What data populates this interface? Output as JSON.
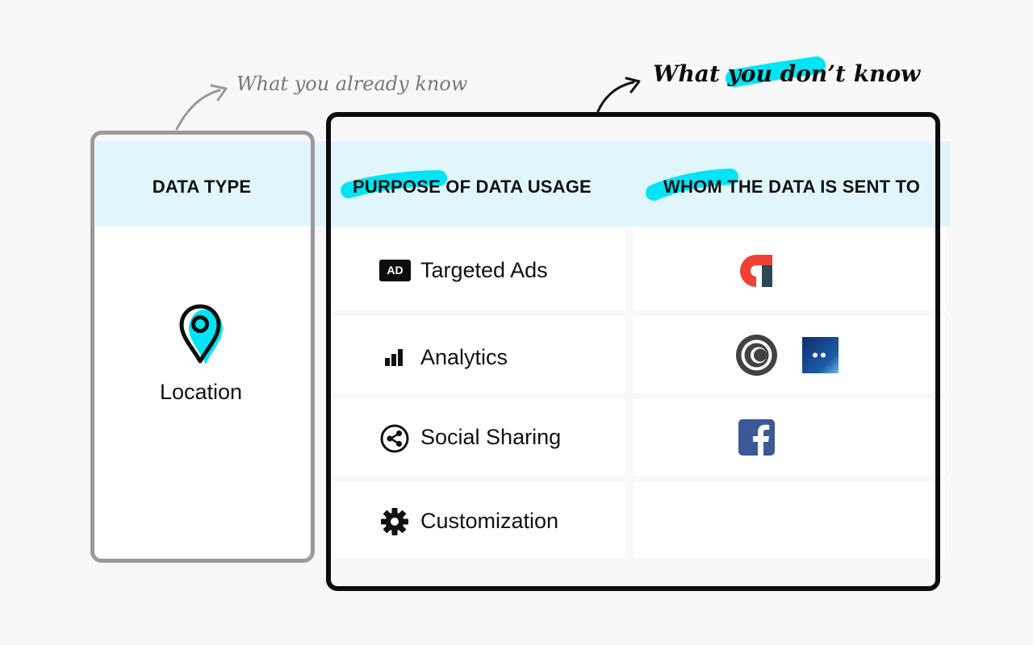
{
  "annotations": {
    "known": "What you already know",
    "unknown": "What you don’t know"
  },
  "headers": {
    "data_type": "DATA TYPE",
    "purpose": "PURPOSE OF DATA USAGE",
    "recipients": "WHOM THE DATA IS SENT TO"
  },
  "data_type": {
    "label": "Location",
    "icon": "location-pin-icon"
  },
  "rows": [
    {
      "label": "Targeted Ads",
      "icon": "ad-badge-icon",
      "badge": "AD",
      "recipients": [
        "red-tracker-logo"
      ]
    },
    {
      "label": "Analytics",
      "icon": "bar-chart-icon",
      "recipients": [
        "circle-logo",
        "blue-dots-logo"
      ]
    },
    {
      "label": "Social Sharing",
      "icon": "share-icon",
      "recipients": [
        "facebook-logo"
      ]
    },
    {
      "label": "Customization",
      "icon": "gear-icon",
      "recipients": []
    }
  ],
  "colors": {
    "highlight": "#00e5f5",
    "header_band": "#e0f6fc",
    "frame_black": "#0d0d0d",
    "frame_gray": "#9a9a9a",
    "facebook": "#3b5998"
  }
}
